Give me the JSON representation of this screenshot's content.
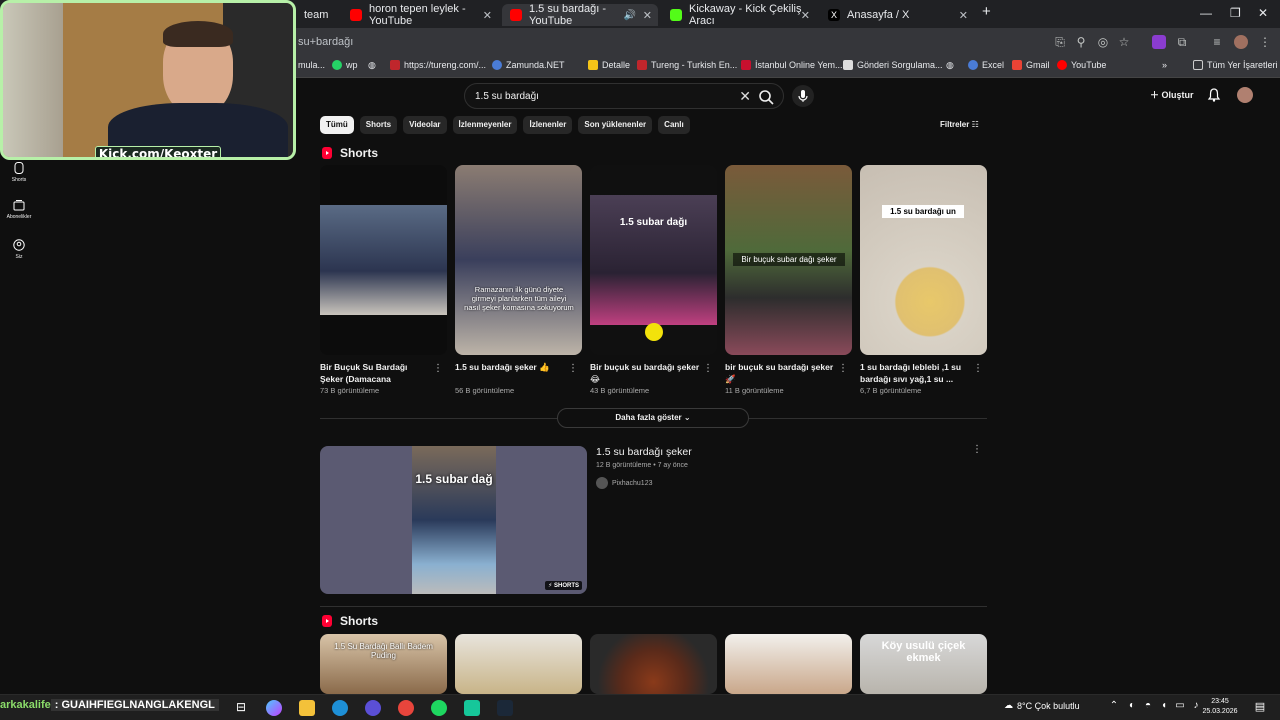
{
  "browser": {
    "tabs": [
      {
        "label": "team"
      },
      {
        "label": "horon tepen leylek - YouTube"
      },
      {
        "label": "1.5 su bardağı - YouTube"
      },
      {
        "label": "Kickaway - Kick Çekiliş Aracı"
      },
      {
        "label": "Anasayfa / X"
      }
    ],
    "url": "su+bardağı",
    "bookmarks": [
      "mula...",
      "wp",
      "https://tureng.com/...",
      "Zamunda.NET",
      "Detalle",
      "Tureng - Turkish En...",
      "İstanbul Online Yem...",
      "Gönderi Sorgulama...",
      "Excel",
      "Gmail",
      "YouTube",
      "Tüm Yer İşaretleri"
    ]
  },
  "youtube": {
    "search_query": "1.5 su bardağı",
    "create_label": "Oluştur",
    "filters_label": "Filtreler",
    "chips": [
      "Tümü",
      "Shorts",
      "Videolar",
      "İzlenmeyenler",
      "İzlenenler",
      "Son yüklenenler",
      "Canlı"
    ],
    "section1_title": "Shorts",
    "section2_title": "Shorts",
    "shorts": [
      {
        "title": "Bir Buçuk Su Bardağı Şeker (Damacana İle)#shorts",
        "views": "73 B görüntüleme",
        "overlay": "",
        "color": "#3b4a60"
      },
      {
        "title": "1.5 su bardağı şeker 👍",
        "views": "56 B görüntüleme",
        "overlay": "Ramazanın ilk günü diyete girmeyi planlarken tüm aileyi nasıl şeker komasına sokuyorum",
        "color": "#6a5d5a"
      },
      {
        "title": "Bir buçuk su bardağı şeker 😂",
        "views": "43 B görüntüleme",
        "overlay": "1.5 subar dağı",
        "color": "#3a2d40"
      },
      {
        "title": "bir buçuk su bardağı şeker 🚀",
        "views": "11 B görüntüleme",
        "overlay": "Bir buçuk subar dağı şeker",
        "color": "#5a6a3a"
      },
      {
        "title": "1 su bardağı leblebi ,1 su bardağı sıvı yağ,1 su ...",
        "views": "6,7 B görüntüleme",
        "overlay": "1.5 su bardağı un",
        "color": "#cfc6b8"
      }
    ],
    "show_more": "Daha fazla göster",
    "video": {
      "title": "1.5 su bardağı şeker",
      "stats": "12 B görüntüleme • 7 ay önce",
      "channel": "Pixhachu123",
      "overlay": "1.5 subar dağ",
      "badge": "SHORTS"
    },
    "shorts2": [
      {
        "overlay": "1.5 Su Bardağı Ballı Badem Puding"
      },
      {
        "overlay": ""
      },
      {
        "overlay": ""
      },
      {
        "overlay": ""
      },
      {
        "overlay": "Köy usulü çiçek ekmek"
      }
    ],
    "left_nav": [
      "Shorts",
      "Abonelikler",
      "Siz"
    ]
  },
  "stream": {
    "kick_label": "Kick.com/Keoxter",
    "marquee_a": "arkakalife",
    "marquee_b": ": GUAIHFIEGLNANGLAKENGL"
  },
  "taskbar": {
    "weather": "8°C  Çok bulutlu",
    "time": "23:45",
    "date": "25.03.2026"
  }
}
